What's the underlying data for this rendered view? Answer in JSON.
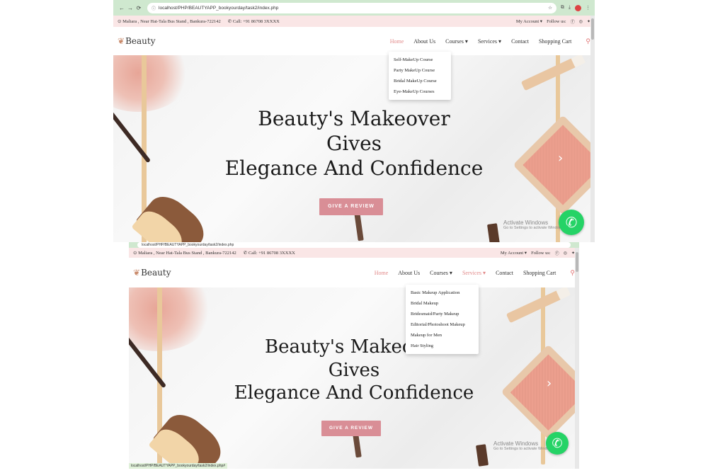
{
  "screen1": {
    "browser": {
      "url": "localhost/PHP/BEAUTYAPP_bookyourday/task2/index.php"
    },
    "topbar": {
      "address": "Maliara , Near Hat-Tala Bus Stand , Bankura-722142",
      "phone": "Call: +91 86708 3XXXX",
      "account": "My Account ▾",
      "follow": "Follow us:"
    },
    "nav": {
      "logo": "Beauty",
      "items": [
        "Home",
        "About Us",
        "Courses ▾",
        "Services ▾",
        "Contact",
        "Shopping Cart"
      ],
      "active": "Home"
    },
    "dropdown": {
      "parent": "Courses",
      "items": [
        "Self-MakeUp Course",
        "Party MakeUp Course",
        "Bridal MakeUp Course",
        "Eye-MakeUp Courses"
      ]
    },
    "hero": {
      "line1": "Beauty's Makeover",
      "line2": "Gives",
      "line3": "Elegance And Confidence",
      "cta": "GIVE A REVIEW"
    },
    "activate": {
      "title": "Activate Windows",
      "sub": "Go to Settings to activate Windows."
    }
  },
  "screen2": {
    "browser": {
      "url": "localhost/PHP/BEAUTYAPP_bookyourday/task2/index.php"
    },
    "topbar": {
      "address": "Maliara , Near Hat-Tala Bus Stand , Bankura-722142",
      "phone": "Call: +91 86708 3XXXX",
      "account": "My Account ▾",
      "follow": "Follow us:"
    },
    "nav": {
      "logo": "Beauty",
      "items": [
        "Home",
        "About Us",
        "Courses ▾",
        "Services ▾",
        "Contact",
        "Shopping Cart"
      ],
      "active": "Services"
    },
    "dropdown": {
      "parent": "Services",
      "items": [
        "Basic Makeup Application",
        "Bridal Makeup",
        "Bridesmaid/Party Makeup",
        "Editorial/Photoshoot Makeup",
        "Makeup for Men",
        "Hair Styling"
      ]
    },
    "hero": {
      "line1": "Beauty's Makeover",
      "line2": "Gives",
      "line3": "Elegance And Confidence",
      "cta": "GIVE A REVIEW"
    },
    "activate": {
      "title": "Activate Windows",
      "sub": "Go to Settings to activate Windows."
    },
    "statusbar": "localhost/PHP/BEAUTYAPP_bookyourday/task2/index.php#"
  },
  "icons": {
    "location": "map-pin-icon",
    "phone": "phone-icon",
    "facebook": "facebook-icon",
    "instagram": "instagram-icon",
    "twitter": "twitter-icon",
    "search": "search-icon",
    "whatsapp": "whatsapp-icon",
    "next": "chevron-right-icon"
  },
  "colors": {
    "browser_chrome": "#cfe8cf",
    "topbar_bg": "#fae6e6",
    "accent": "#e28a8a",
    "cta_bg": "#d98e96",
    "whatsapp": "#25d366"
  }
}
